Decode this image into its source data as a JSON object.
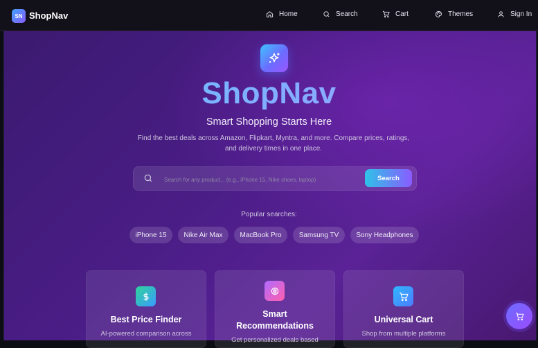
{
  "nav": {
    "logo_badge": "SN",
    "logo_text": "ShopNav",
    "items": [
      {
        "label": "Home",
        "icon": "home-icon"
      },
      {
        "label": "Search",
        "icon": "search-icon"
      },
      {
        "label": "Cart",
        "icon": "cart-icon"
      },
      {
        "label": "Themes",
        "icon": "palette-icon"
      },
      {
        "label": "Sign In",
        "icon": "user-icon"
      }
    ]
  },
  "hero": {
    "icon": "sparkles-icon",
    "title": "ShopNav",
    "subtitle": "Smart Shopping Starts Here",
    "description": "Find the best deals across Amazon, Flipkart, Myntra, and more. Compare prices, ratings, and delivery times in one place."
  },
  "search": {
    "placeholder": "Search for any product... (e.g., iPhone 15, Nike shoes, laptop)",
    "button_label": "Search"
  },
  "popular": {
    "label": "Popular searches:",
    "chips": [
      "iPhone 15",
      "Nike Air Max",
      "MacBook Pro",
      "Samsung TV",
      "Sony Headphones"
    ]
  },
  "features": [
    {
      "title": "Best Price Finder",
      "description": "AI-powered comparison across",
      "icon": "dollar-icon"
    },
    {
      "title": "Smart Recommendations",
      "description": "Get personalized deals based",
      "icon": "brain-icon"
    },
    {
      "title": "Universal Cart",
      "description": "Shop from multiple platforms",
      "icon": "cart-icon"
    }
  ],
  "fab": {
    "icon": "cart-icon"
  },
  "colors": {
    "accent_from": "#2ec3e8",
    "accent_to": "#8a5cff",
    "background": "#4a1d86"
  }
}
